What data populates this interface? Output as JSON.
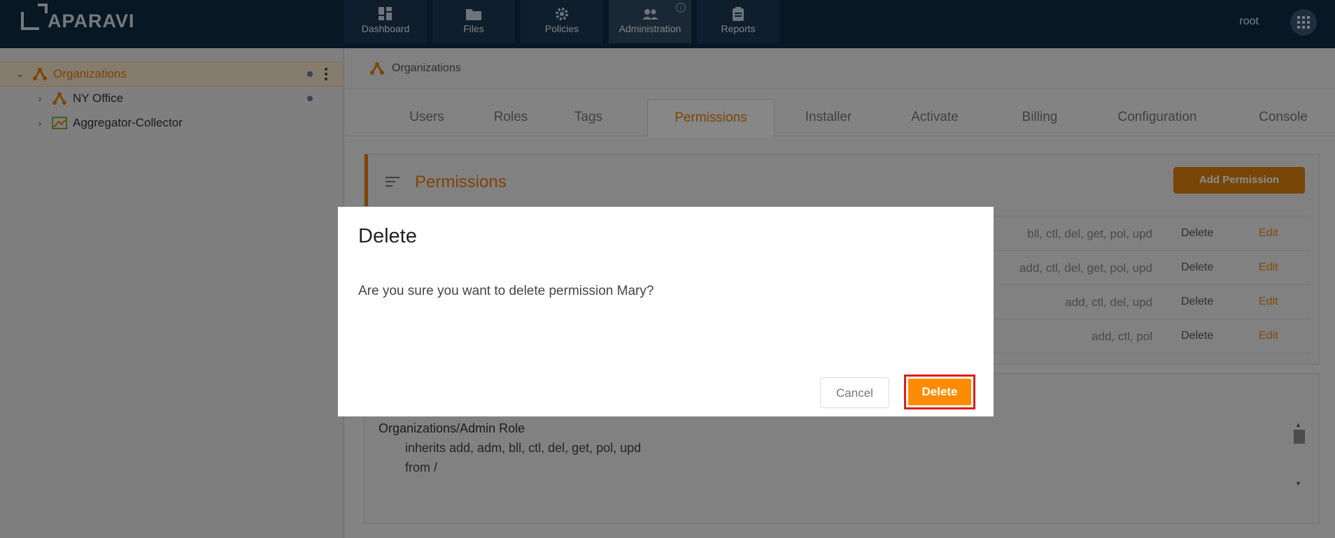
{
  "app": {
    "logo_text": "APARAVI"
  },
  "nav": {
    "items": [
      {
        "label": "Dashboard",
        "icon": "dashboard-icon"
      },
      {
        "label": "Files",
        "icon": "folder-icon"
      },
      {
        "label": "Policies",
        "icon": "gear-icon"
      },
      {
        "label": "Administration",
        "icon": "users-icon",
        "active": true
      },
      {
        "label": "Reports",
        "icon": "clipboard-icon"
      }
    ],
    "info_glyph": "i",
    "user": "root"
  },
  "tree": {
    "items": [
      {
        "label": "Organizations",
        "selected": true
      },
      {
        "label": "NY Office"
      },
      {
        "label": "Aggregator-Collector"
      }
    ]
  },
  "breadcrumb": {
    "label": "Organizations"
  },
  "tabs": [
    {
      "label": "Users"
    },
    {
      "label": "Roles"
    },
    {
      "label": "Tags"
    },
    {
      "label": "Permissions",
      "active": true
    },
    {
      "label": "Installer"
    },
    {
      "label": "Activate"
    },
    {
      "label": "Billing"
    },
    {
      "label": "Configuration"
    },
    {
      "label": "Console"
    }
  ],
  "permissions": {
    "title": "Permissions",
    "add_button": "Add Permission",
    "rows": [
      {
        "rights": "bll, ctl, del, get, pol, upd",
        "delete": "Delete",
        "edit": "Edit"
      },
      {
        "rights": "add, ctl, del, get, pol, upd",
        "delete": "Delete",
        "edit": "Edit"
      },
      {
        "rights": "add, ctl, del, upd",
        "delete": "Delete",
        "edit": "Edit"
      },
      {
        "rights": "add, ctl, pol",
        "delete": "Delete",
        "edit": "Edit"
      }
    ]
  },
  "inheritance": {
    "title": "Organizations/Admin Role",
    "line1": "inherits add, adm, bll, ctl, del, get, pol, upd",
    "line2": "from /"
  },
  "dialog": {
    "title": "Delete",
    "message": "Are you sure you want to delete permission Mary?",
    "cancel_label": "Cancel",
    "delete_label": "Delete"
  },
  "colors": {
    "nav_bg": "#0f2a43",
    "accent": "#e87c0c",
    "delete_button": "#ff8c00",
    "highlight_border": "#e01b1b"
  }
}
